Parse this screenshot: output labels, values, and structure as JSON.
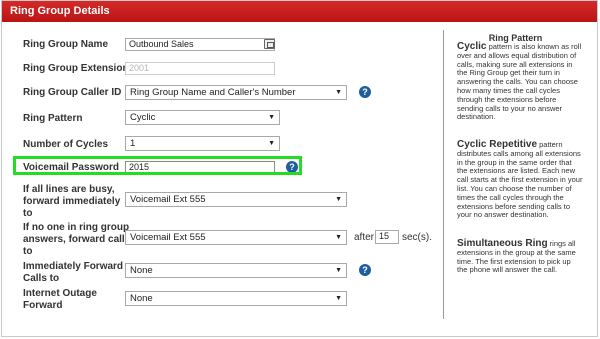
{
  "window": {
    "title": "Ring Group Details"
  },
  "form": {
    "name": {
      "label": "Ring Group Name",
      "value": "Outbound Sales"
    },
    "extension": {
      "label": "Ring Group Extension",
      "value": "2001"
    },
    "caller_id": {
      "label": "Ring Group Caller ID",
      "value": "Ring Group Name and Caller's Number"
    },
    "ring_pattern": {
      "label": "Ring Pattern",
      "value": "Cyclic"
    },
    "cycles": {
      "label": "Number of Cycles",
      "value": "1"
    },
    "voicemail_password": {
      "label": "Voicemail Password",
      "value": "2015"
    },
    "busy_forward": {
      "label_line1": "If all lines are busy,",
      "label_line2": "forward immediately",
      "label_line3": "to",
      "value": "Voicemail Ext 555"
    },
    "no_answer_forward": {
      "label_line1": "If no one in ring group",
      "label_line2": "answers, forward call",
      "label_line3": "to",
      "value": "Voicemail Ext 555",
      "after_label": "after",
      "after_value": "15",
      "unit": "sec(s)."
    },
    "immediate_forward": {
      "label_line1": "Immediately Forward",
      "label_line2": "Calls to",
      "value": "None"
    },
    "outage_forward": {
      "label_line1": "Internet Outage",
      "label_line2": "Forward",
      "value": "None"
    }
  },
  "help_panel": {
    "title": "Ring Pattern",
    "cyclic": {
      "heading": "Cyclic",
      "lines": [
        "pattern is also known as roll",
        "over and allows equal distribution of",
        "calls, making sure all extensions in",
        "the Ring Group get their turn in",
        "answering the calls. You can choose",
        "how many times the call cycles",
        "through the extensions before",
        "sending calls to your no answer",
        "destination."
      ]
    },
    "cyclic_repetitive": {
      "heading": "Cyclic Repetitive",
      "lines": [
        "pattern",
        "distributes calls among all extensions",
        "in the group in the same order that",
        "the extensions are listed. Each new",
        "call starts at the first extension in your",
        "list. You can choose the number of",
        "times the call cycles through the",
        "extensions before sending calls to",
        "your no answer destination."
      ]
    },
    "simultaneous": {
      "heading": "Simultaneous Ring",
      "lines": [
        "rings all",
        "extensions in the group at the same",
        "time. The first extension to pick up",
        "the phone will answer the call."
      ]
    }
  },
  "icons": {
    "help": "question-icon",
    "card": "contact-card-icon",
    "dropdown": "chevron-down-icon"
  },
  "colors": {
    "titlebar": "#c41f1f",
    "highlight": "#22dd22",
    "help_icon": "#1f5d9e"
  }
}
